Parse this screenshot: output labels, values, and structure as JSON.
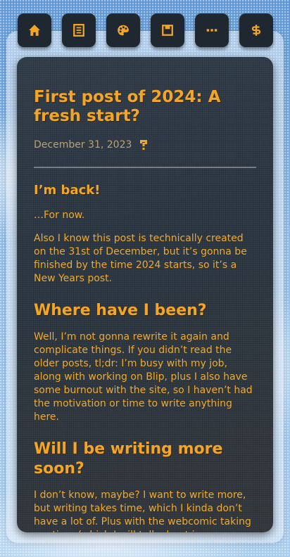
{
  "nav": {
    "items": [
      {
        "icon": "home-icon"
      },
      {
        "icon": "list-icon"
      },
      {
        "icon": "palette-icon"
      },
      {
        "icon": "save-icon"
      },
      {
        "icon": "more-icon"
      },
      {
        "icon": "dollar-icon"
      }
    ]
  },
  "colors": {
    "accent": "#f2a627",
    "card_bg": "#2c3844",
    "nav_bg": "#1f2730",
    "meta": "#b8a273"
  },
  "post": {
    "title": "First post of 2024: A fresh start?",
    "date": "December 31, 2023",
    "sections": [
      {
        "heading": "I’m back!",
        "paragraphs": [
          "…For now.",
          "Also I know this post is technically created on the 31st of December, but it’s gonna be finished by the time 2024 starts, so it’s a New Years post."
        ]
      },
      {
        "heading": "Where have I been?",
        "paragraphs": [
          "Well, I’m not gonna rewrite it again and complicate things. If you didn’t read the older posts, tl;dr: I’m busy with my job, along with working on Blip, plus I also have some burnout with the site, so I haven’t had the motivation or time to write anything here."
        ]
      },
      {
        "heading": "Will I be writing more soon?",
        "paragraphs": [
          "I don’t know, maybe? I want to write more, but writing takes time, which I kinda don’t have a lot of. Plus with the webcomic taking my time (which I will talk about in a"
        ]
      }
    ]
  }
}
